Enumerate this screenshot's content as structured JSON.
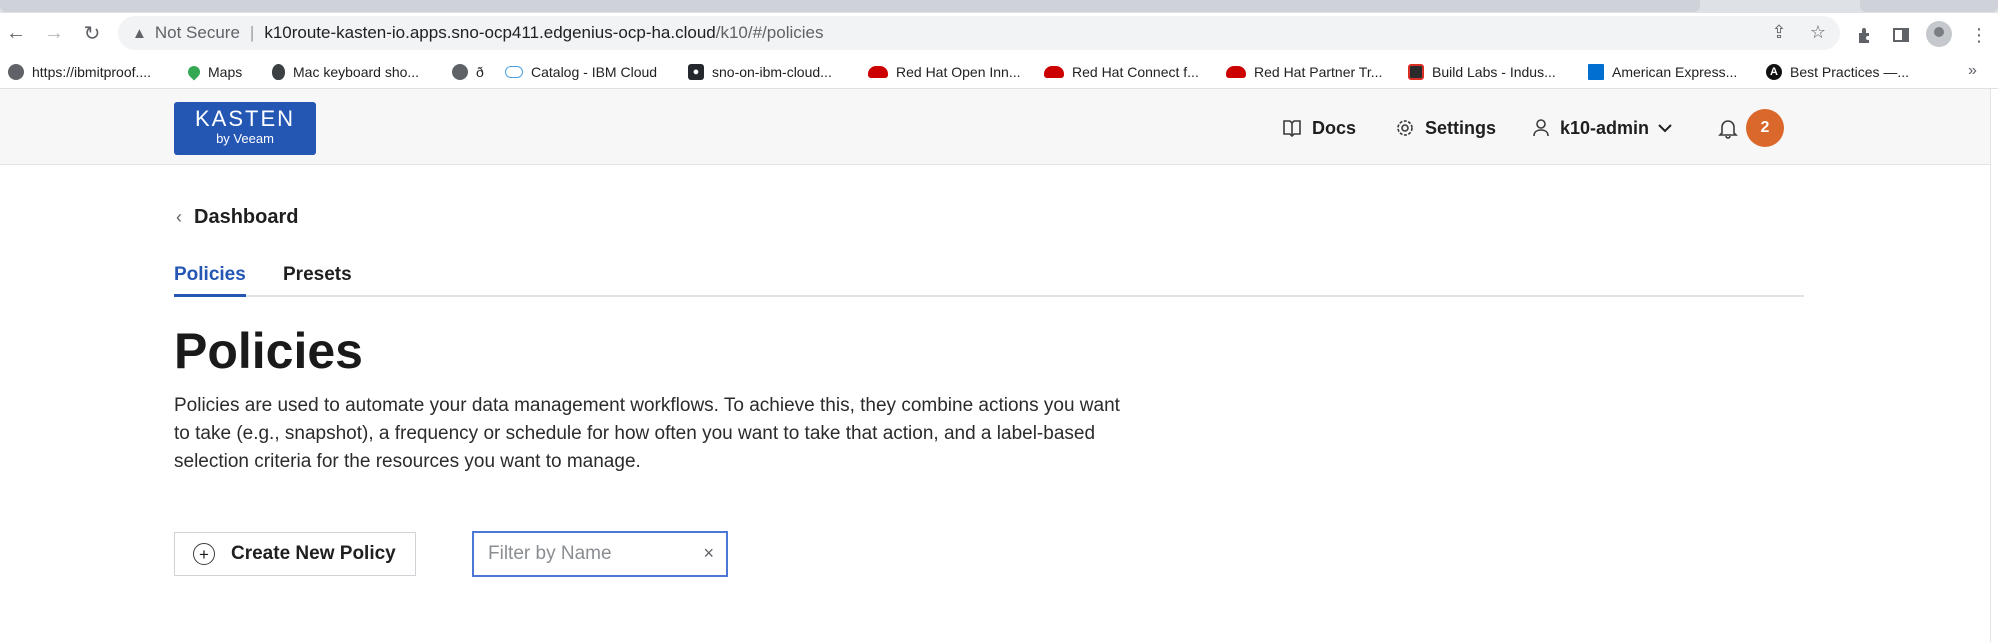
{
  "browser": {
    "address": {
      "security_label": "Not Secure",
      "separator": "|",
      "host": "k10route-kasten-io.apps.sno-ocp411.edgenius-ocp-ha.cloud",
      "path": "/k10/#/policies"
    },
    "bookmarks": [
      {
        "label": "https://ibmitproof....",
        "icon": "globe-icon"
      },
      {
        "label": "Maps",
        "icon": "maps-icon"
      },
      {
        "label": "Mac keyboard sho...",
        "icon": "apple-icon"
      },
      {
        "label": "ð",
        "icon": "globe-icon"
      },
      {
        "label": "Catalog - IBM Cloud",
        "icon": "cloud-icon"
      },
      {
        "label": "sno-on-ibm-cloud...",
        "icon": "github-icon"
      },
      {
        "label": "Red Hat Open Inn...",
        "icon": "redhat-icon"
      },
      {
        "label": "Red Hat Connect f...",
        "icon": "redhat-icon"
      },
      {
        "label": "Red Hat Partner Tr...",
        "icon": "redhat-icon"
      },
      {
        "label": "Build Labs - Indus...",
        "icon": "buildlabs-icon"
      },
      {
        "label": "American Express...",
        "icon": "amex-icon"
      },
      {
        "label": "Best Practices —...",
        "icon": "a-icon"
      }
    ],
    "more_bookmarks": "»"
  },
  "header": {
    "logo_line1": "KASTEN",
    "logo_line2": "by Veeam",
    "docs_label": "Docs",
    "settings_label": "Settings",
    "user_label": "k10-admin",
    "notification_count": "2"
  },
  "main": {
    "back_label": "Dashboard",
    "tabs": [
      {
        "label": "Policies",
        "active": true
      },
      {
        "label": "Presets",
        "active": false
      }
    ],
    "title": "Policies",
    "description": "Policies are used to automate your data management workflows. To achieve this, they combine actions you want to take (e.g., snapshot), a frequency or schedule for how often you want to take that action, and a label-based selection criteria for the resources you want to manage.",
    "create_button_label": "Create New Policy",
    "filter": {
      "placeholder": "Filter by Name",
      "value": "",
      "clear": "×"
    }
  },
  "colors": {
    "brand_blue": "#2456b4",
    "badge_orange": "#d9682a",
    "focus_border": "#4a78d4"
  }
}
